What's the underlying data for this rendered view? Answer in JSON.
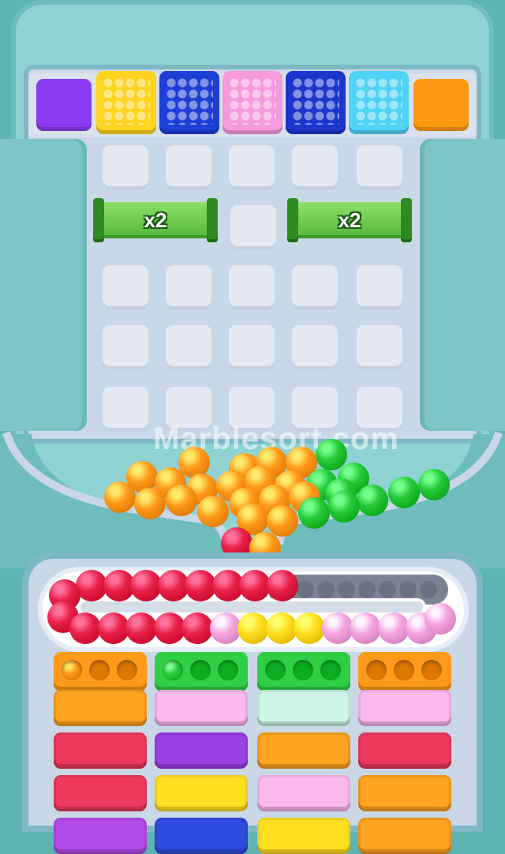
{
  "watermark": "Marblesort.com",
  "multipliers": [
    {
      "label": "x2"
    },
    {
      "label": "x2"
    }
  ],
  "top_blocks": [
    {
      "color": "#8a3df0",
      "studded": false
    },
    {
      "color": "#ffd31f",
      "studded": true
    },
    {
      "color": "#1e3fd6",
      "studded": true
    },
    {
      "color": "#f59bdc",
      "studded": true
    },
    {
      "color": "#1c35cc",
      "studded": true
    },
    {
      "color": "#4fd3f7",
      "studded": true
    },
    {
      "color": "#ff9a12",
      "studded": false
    }
  ],
  "pile": {
    "orange": "#ff9a1a",
    "green": "#25c93a",
    "red": "#e8204a"
  },
  "conveyor": {
    "top_row": [
      "#e8204a",
      "#e8204a",
      "#e8204a",
      "#e8204a",
      "#e8204a",
      "#e8204a",
      "#e8204a",
      "#e8204a"
    ],
    "bottom_row": [
      "#e8204a",
      "#e8204a",
      "#e8204a",
      "#e8204a",
      "#e8204a",
      "#f5a4e0",
      "#ffdd1e",
      "#ffdd1e",
      "#ffdd1e",
      "#f5a4e0",
      "#f5a4e0",
      "#f5a4e0",
      "#f5a4e0"
    ],
    "left_end": "#e8204a",
    "right_end": "#f5a4e0",
    "empty_slots": 8
  },
  "containers": [
    {
      "top": "#ff9a1a",
      "holes_filled": 1,
      "stack": [
        "#ffa320",
        "#ee3a5e",
        "#ee3a5e",
        "#b24be6"
      ]
    },
    {
      "top": "#2fcf45",
      "holes_filled": 1,
      "stack": [
        "#fab8ec",
        "#9a3ee6",
        "#ffe020",
        "#2f4ce0"
      ]
    },
    {
      "top": "#2fcf45",
      "holes_filled": 0,
      "stack": [
        "#cdf6e6",
        "#ffa320",
        "#fab8ec",
        "#ffe020"
      ]
    },
    {
      "top": "#ff9a1a",
      "holes_filled": 0,
      "stack": [
        "#fab8ec",
        "#ee3a5e",
        "#ffa320",
        "#ffa320"
      ]
    }
  ]
}
